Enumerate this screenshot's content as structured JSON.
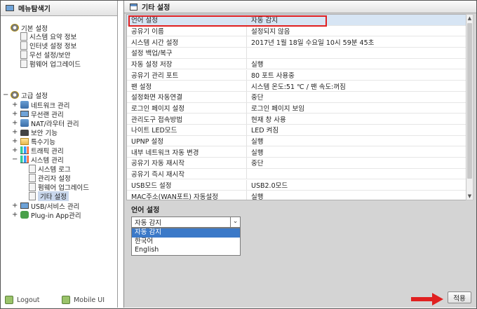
{
  "sidebar": {
    "header": "메뉴탐색기",
    "basic": {
      "label": "기본 설정",
      "items": [
        "시스템 요약 정보",
        "인터넷 설정 정보",
        "무선 설정/보안",
        "펌웨어 업그레이드"
      ]
    },
    "advanced": {
      "label": "고급 설정",
      "groups": [
        "네트워크 관리",
        "무선랜 관리",
        "NAT/라우터 관리",
        "보안 기능",
        "특수기능",
        "트래픽 관리",
        "시스템 관리"
      ],
      "system_children": [
        "시스템 로그",
        "관리자 설정",
        "펌웨어 업그레이드",
        "기타 설정"
      ],
      "more_groups": [
        "USB/서비스 관리",
        "Plug-in App관리"
      ]
    },
    "footer": {
      "logout": "Logout",
      "mobile": "Mobile UI"
    }
  },
  "main": {
    "title": "기타 설정",
    "rows": [
      {
        "k": "언어 설정",
        "v": "자동 감지"
      },
      {
        "k": "공유기 이름",
        "v": "설정되지 않음"
      },
      {
        "k": "시스템 시간 설정",
        "v": "2017년 1월 18일 수요일 10시 59분 45초"
      },
      {
        "k": "설정 백업/복구",
        "v": ""
      },
      {
        "k": "자동 설정 저장",
        "v": "실행"
      },
      {
        "k": "공유기 관리 포트",
        "v": "80 포트 사용중"
      },
      {
        "k": "팬 설정",
        "v": "시스템 온도:51 ℃ / 팬 속도:꺼짐"
      },
      {
        "k": "설정화면 자동연결",
        "v": "중단"
      },
      {
        "k": "로그인 페이지 설정",
        "v": "로그인 페이지 보임"
      },
      {
        "k": "관리도구 접속방법",
        "v": "현재 창 사용"
      },
      {
        "k": "나이트 LED모드",
        "v": "LED 켜짐"
      },
      {
        "k": "UPNP 설정",
        "v": "실행"
      },
      {
        "k": "내부 네트워크 자동 변경",
        "v": "실행"
      },
      {
        "k": "공유기 자동 재시작",
        "v": "중단"
      },
      {
        "k": "공유기 즉시 재시작",
        "v": ""
      },
      {
        "k": "USB모드 설정",
        "v": "USB2.0모드"
      },
      {
        "k": "MAC주소(WAN포트) 자동설정",
        "v": "실행"
      }
    ],
    "section_title": "언어 설정",
    "language": {
      "selected": "자동 감지",
      "options": [
        "자동 감지",
        "한국어",
        "English"
      ]
    },
    "apply_label": "적용"
  },
  "colors": {
    "highlight_row": "#d7e5f4",
    "selected_option": "#3b79c8",
    "annotation_red": "#e02020"
  }
}
